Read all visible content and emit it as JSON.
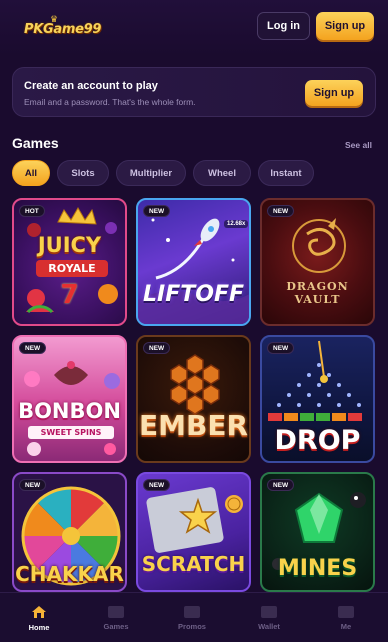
{
  "header": {
    "logo_text": "PKGame99",
    "login_label": "Log in",
    "signup_label": "Sign up"
  },
  "promo": {
    "title": "Create an account to play",
    "subtitle": "Email and a password. That's the whole form.",
    "cta_label": "Sign up"
  },
  "games": {
    "title": "Games",
    "see_all": "See all",
    "filters": [
      "All",
      "Slots",
      "Multiplier",
      "Wheel",
      "Instant"
    ],
    "active_filter": "All",
    "tiles": [
      {
        "name": "JUICY ROYALE",
        "badge": "HOT"
      },
      {
        "name": "LIFTOFF",
        "badge": "NEW"
      },
      {
        "name": "DRAGON VAULT",
        "badge": "NEW"
      },
      {
        "name": "BONBON SWEET SPINS",
        "badge": "NEW"
      },
      {
        "name": "EMBER",
        "badge": "NEW"
      },
      {
        "name": "DROP",
        "badge": "NEW"
      },
      {
        "name": "CHAKKAR",
        "badge": "NEW"
      },
      {
        "name": "SCRATCH",
        "badge": "NEW"
      },
      {
        "name": "MINES",
        "badge": "NEW"
      }
    ]
  },
  "tile_art": {
    "juicy_line1": "JUICY",
    "juicy_line2": "ROYALE",
    "liftoff": "LIFTOFF",
    "liftoff_mult": "12.68x",
    "dragon_line1": "DRAGON",
    "dragon_line2": "VAULT",
    "bonbon_line1": "BONBON",
    "bonbon_line2": "SWEET SPINS",
    "ember": "EMBER",
    "drop": "DROP",
    "chakkar": "CHAKKAR",
    "scratch": "SCRATCH",
    "mines": "MINES"
  },
  "nav": {
    "items": [
      "Home",
      "Games",
      "Promos",
      "Wallet",
      "Me"
    ],
    "active": "Home"
  },
  "colors": {
    "background": "#1a0b2e",
    "accent_gold": "#f6b337",
    "card": "#2a1946"
  }
}
